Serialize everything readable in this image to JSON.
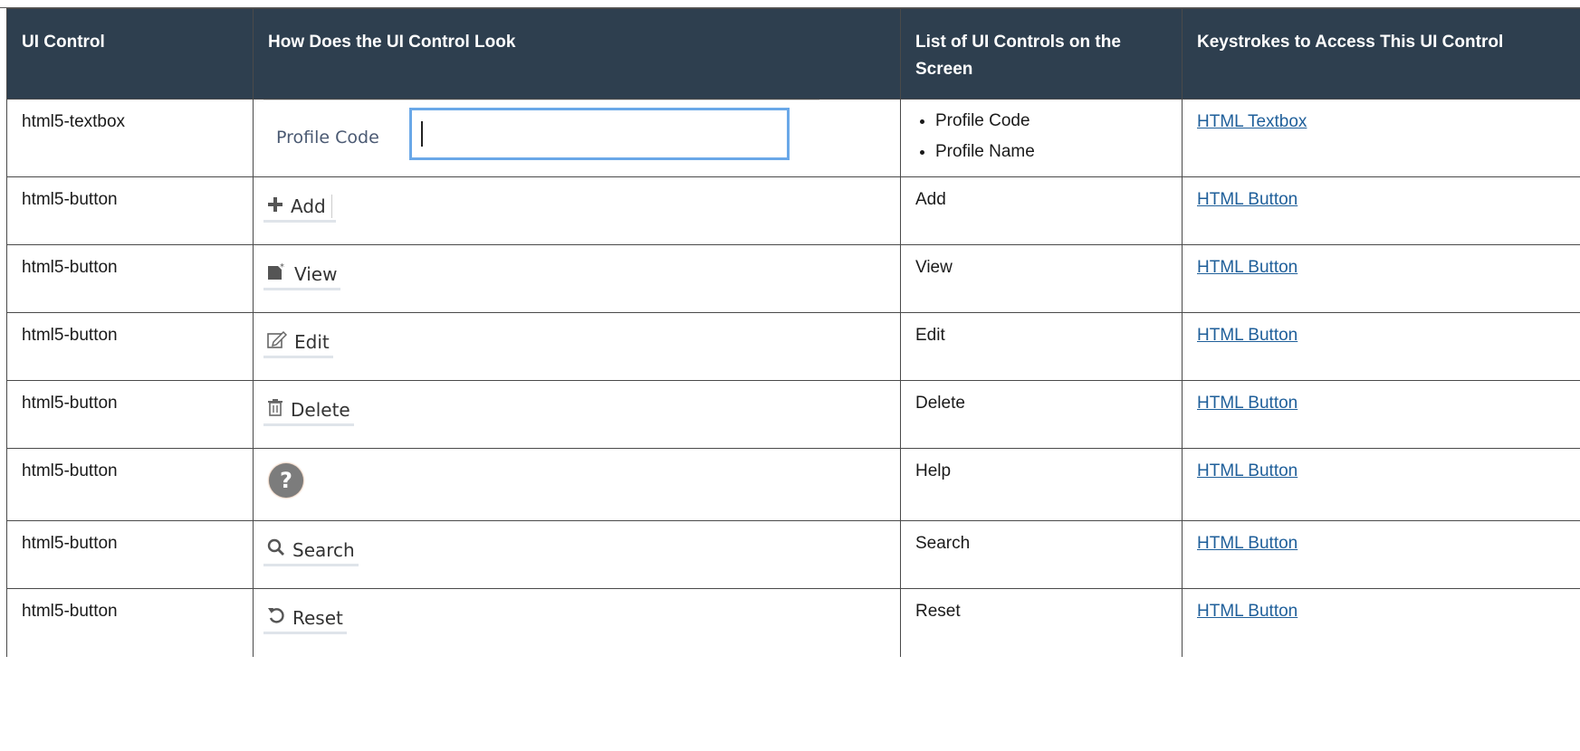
{
  "table": {
    "headers": [
      "UI Control",
      "How Does the UI Control Look",
      "List of UI Controls on the Screen",
      "Keystrokes to Access This UI Control"
    ],
    "rows": [
      {
        "control": "html5-textbox",
        "look": {
          "kind": "textbox",
          "label": "Profile Code",
          "icon": "text-cursor-icon"
        },
        "list": [
          "Profile Code",
          "Profile Name"
        ],
        "link": "HTML Textbox"
      },
      {
        "control": "html5-button",
        "look": {
          "kind": "button",
          "label": "Add",
          "icon": "plus-icon"
        },
        "list": [
          "Add"
        ],
        "link": "HTML Button"
      },
      {
        "control": "html5-button",
        "look": {
          "kind": "button",
          "label": "View",
          "icon": "view-document-icon"
        },
        "list": [
          "View"
        ],
        "link": "HTML Button"
      },
      {
        "control": "html5-button",
        "look": {
          "kind": "button",
          "label": "Edit",
          "icon": "edit-pencil-icon"
        },
        "list": [
          "Edit"
        ],
        "link": "HTML Button"
      },
      {
        "control": "html5-button",
        "look": {
          "kind": "button",
          "label": "Delete",
          "icon": "trash-icon"
        },
        "list": [
          "Delete"
        ],
        "link": "HTML Button"
      },
      {
        "control": "html5-button",
        "look": {
          "kind": "help",
          "label": "?",
          "icon": "help-circle-icon"
        },
        "list": [
          "Help"
        ],
        "link": "HTML Button"
      },
      {
        "control": "html5-button",
        "look": {
          "kind": "button",
          "label": "Search",
          "icon": "search-icon"
        },
        "list": [
          "Search"
        ],
        "link": "HTML Button"
      },
      {
        "control": "html5-button",
        "look": {
          "kind": "button",
          "label": "Reset",
          "icon": "reset-arrow-icon"
        },
        "list": [
          "Reset"
        ],
        "link": "HTML Button"
      }
    ]
  },
  "colors": {
    "header_bg": "#2e3f4f",
    "header_text": "#ffffff",
    "link": "#1f5f9a",
    "textbox_border": "#6aa8e8",
    "help_icon": "#7c7c7c"
  }
}
